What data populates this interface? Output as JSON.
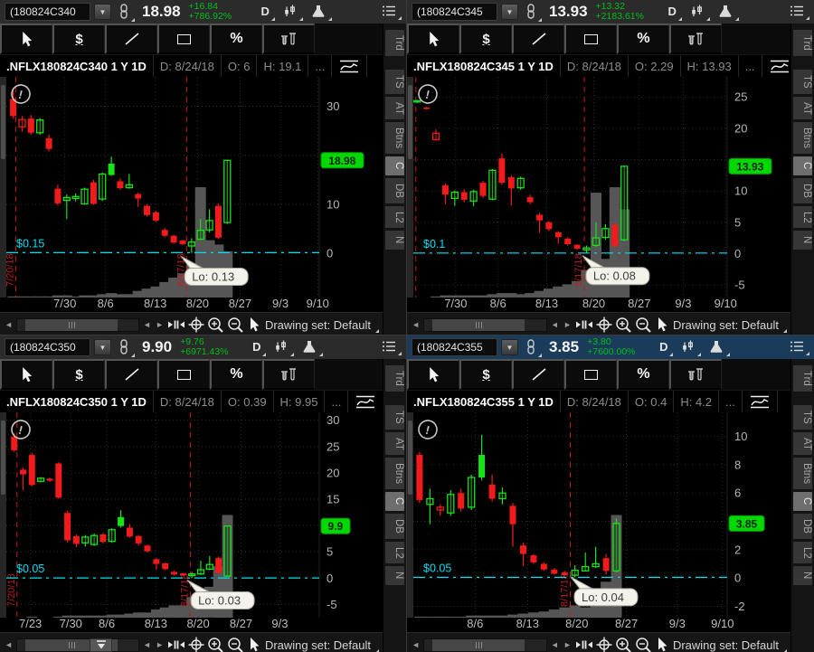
{
  "colors": {
    "candle_up": "#17e317",
    "candle_down": "#f21b1b",
    "alert_line": "#00dff2",
    "badge_bg": "#00d800",
    "date_line_red": "#c51a1a",
    "active_header_bg": "#1a3c5a",
    "change_green": "#00be18"
  },
  "sidebar_tabs": [
    "Trd",
    "TS",
    "AT",
    "Btns",
    "C",
    "DB",
    "L2",
    "N"
  ],
  "toolbar": {
    "drawing_set": "Drawing set: Default",
    "dollar": "$",
    "percent": "%"
  },
  "panels": [
    {
      "active": false,
      "show_snap": false,
      "header": {
        "symbol": "(180824C340",
        "price": "18.98",
        "change": "+16.84",
        "change_pct": "+786.92%",
        "timeframe": "D"
      },
      "title": {
        "name": ".NFLX180824C340 1 Y 1D",
        "date": "D: 8/24/18",
        "open": "O: 6",
        "high": "H: 19.1",
        "more": "..."
      },
      "chart": {
        "ylim": [
          -9,
          36
        ],
        "grid_step": 10,
        "x0": 0.022,
        "dx": 0.0285,
        "yticks": [
          [
            30,
            "30"
          ],
          [
            10,
            "10"
          ],
          [
            0,
            "0"
          ]
        ],
        "xticks": [
          [
            0.187,
            "7/30"
          ],
          [
            0.317,
            "8/6"
          ],
          [
            0.476,
            "8/13"
          ],
          [
            0.611,
            "8/20"
          ],
          [
            0.747,
            "8/27"
          ],
          [
            0.876,
            "9/3"
          ],
          [
            0.995,
            "9/10"
          ]
        ],
        "vlines": [
          {
            "frac": 0.03,
            "label": "7/20/18"
          },
          {
            "frac": 0.576,
            "label": "8/17/18"
          }
        ],
        "hline": {
          "price": 0.15,
          "label": "$0.15"
        },
        "badge": {
          "value": "18.98",
          "price": 18.98
        },
        "tooltip": {
          "text": "Lo: 0.13",
          "frac": 0.57,
          "price": -3
        },
        "candles": [
          [
            31.5,
            33.5,
            27.5,
            28,
            "r",
            0.01
          ],
          [
            25.8,
            28,
            24.8,
            27.3,
            "rh",
            0.01
          ],
          [
            27.5,
            28.2,
            24.2,
            24.6,
            "r",
            0.01
          ],
          [
            24.6,
            27.6,
            24.2,
            27.2,
            "gh",
            0.01
          ],
          [
            23.5,
            24.2,
            20.8,
            21.3,
            "r",
            0.01
          ],
          [
            13.2,
            14,
            9.8,
            10.2,
            "r",
            0.02
          ],
          [
            10.8,
            12,
            7,
            11.4,
            "gh",
            0.02
          ],
          [
            11.2,
            12.2,
            10.6,
            11.6,
            "gh",
            0.01
          ],
          [
            10.1,
            13.4,
            9.9,
            13.1,
            "gh",
            0.02
          ],
          [
            14.5,
            15,
            9.9,
            10.1,
            "r",
            0.02
          ],
          [
            11.1,
            16.5,
            10.7,
            16.2,
            "gh",
            0.03
          ],
          [
            16,
            19.7,
            15.8,
            18.3,
            "g",
            0.04
          ],
          [
            14.7,
            15.3,
            13,
            13.3,
            "r",
            0.03
          ],
          [
            13.4,
            16.2,
            13.2,
            14,
            "gh",
            0.03
          ],
          [
            12.1,
            12.4,
            9.5,
            11.2,
            "r",
            0.06
          ],
          [
            9.7,
            10,
            7.5,
            7.8,
            "r",
            0.08
          ],
          [
            8.4,
            8.6,
            6.4,
            6.7,
            "r",
            0.1
          ],
          [
            4.8,
            5.2,
            3.3,
            3.6,
            "r",
            0.14
          ],
          [
            3.6,
            3.8,
            2,
            2.2,
            "r",
            0.18
          ],
          [
            2.6,
            2.8,
            1.7,
            1.9,
            "r",
            0.22
          ],
          [
            1.5,
            3.1,
            0.13,
            2.3,
            "gh",
            0.3
          ],
          [
            2.9,
            7,
            2.7,
            4.7,
            "gh",
            1.0
          ],
          [
            4.8,
            9,
            4.3,
            6.7,
            "gh",
            0.52
          ],
          [
            9.7,
            10.2,
            2.9,
            3.2,
            "r",
            0.48
          ],
          [
            6.3,
            19.1,
            6,
            18.98,
            "gh",
            0.42
          ]
        ]
      }
    },
    {
      "active": false,
      "show_snap": false,
      "header": {
        "symbol": "(180824C345",
        "price": "13.93",
        "change": "+13.32",
        "change_pct": "+2183.61%",
        "timeframe": "D"
      },
      "title": {
        "name": ".NFLX180824C345 1 Y 1D",
        "date": "D: 8/24/18",
        "open": "O: 2.29",
        "high": "H: 13.93",
        "more": "..."
      },
      "chart": {
        "ylim": [
          -7,
          28.2
        ],
        "grid_step": 5,
        "x0": 0.012,
        "dx": 0.03,
        "yticks": [
          [
            25,
            "25"
          ],
          [
            20,
            "20"
          ],
          [
            10,
            "10"
          ],
          [
            5,
            "5"
          ],
          [
            0,
            "0"
          ],
          [
            -5,
            "-5"
          ]
        ],
        "xticks": [
          [
            0.135,
            "7/30"
          ],
          [
            0.27,
            "8/6"
          ],
          [
            0.425,
            "8/13"
          ],
          [
            0.575,
            "8/20"
          ],
          [
            0.72,
            "8/27"
          ],
          [
            0.86,
            "9/3"
          ],
          [
            0.995,
            "9/10"
          ]
        ],
        "vlines": [
          {
            "frac": 0.008,
            "label": ""
          },
          {
            "frac": 0.545,
            "label": "8/17/18"
          }
        ],
        "hline": {
          "price": 0.1,
          "label": "$0.1"
        },
        "badge": {
          "value": "13.93",
          "price": 13.93
        },
        "tooltip": {
          "text": "Lo: 0.08",
          "frac": 0.55,
          "price": -2.2
        },
        "candles": [
          [
            24.2,
            24.5,
            24,
            24.4,
            "gh",
            0
          ],
          [
            23.1,
            23.4,
            23,
            23.3,
            "r",
            0
          ],
          [
            18.2,
            19.8,
            18,
            19.2,
            "rh",
            0.01
          ],
          [
            10.9,
            11.2,
            7.9,
            9.4,
            "r",
            0.02
          ],
          [
            8.8,
            10.1,
            7.6,
            9.8,
            "gh",
            0.02
          ],
          [
            9.8,
            10.3,
            8.2,
            8.6,
            "r",
            0.02
          ],
          [
            8.4,
            10.2,
            7.6,
            9.9,
            "gh",
            0.02
          ],
          [
            11.3,
            11.6,
            8.9,
            9.2,
            "r",
            0.02
          ],
          [
            8.7,
            13.5,
            8.5,
            13.3,
            "gh",
            0.03
          ],
          [
            15.2,
            16,
            11,
            11.3,
            "r",
            0.04
          ],
          [
            12.2,
            12.5,
            7.7,
            10.4,
            "r",
            0.04
          ],
          [
            10.5,
            12.3,
            10.2,
            12,
            "gh",
            0.03
          ],
          [
            9,
            9.4,
            7.9,
            8.2,
            "r",
            0.04
          ],
          [
            6.2,
            6.5,
            3.3,
            5.3,
            "r",
            0.06
          ],
          [
            5,
            5.2,
            3.6,
            3.9,
            "r",
            0.08
          ],
          [
            3.4,
            3.6,
            1.6,
            2.6,
            "r",
            0.1
          ],
          [
            2.4,
            2.6,
            1.3,
            1.5,
            "r",
            0.12
          ],
          [
            1.4,
            1.5,
            0.6,
            0.8,
            "r",
            0.15
          ],
          [
            0.6,
            1.3,
            0.08,
            0.9,
            "gh",
            0.25
          ],
          [
            1.3,
            5,
            1,
            2.5,
            "gh",
            0.95
          ],
          [
            2.6,
            4.7,
            2.2,
            4,
            "gh",
            0.35
          ],
          [
            4.6,
            5,
            0.9,
            1.2,
            "r",
            1.0
          ],
          [
            2.2,
            14,
            2,
            13.93,
            "gh",
            0.8
          ]
        ]
      }
    },
    {
      "active": false,
      "show_snap": true,
      "header": {
        "symbol": "(180824C350",
        "price": "9.90",
        "change": "+9.76",
        "change_pct": "+6971.43%",
        "timeframe": "D"
      },
      "title": {
        "name": ".NFLX180824C350 1 Y 1D",
        "date": "D: 8/24/18",
        "open": "O: 0.39",
        "high": "H: 9.95",
        "more": "..."
      },
      "chart": {
        "ylim": [
          -7.5,
          31.5
        ],
        "grid_step": 5,
        "x0": 0.025,
        "dx": 0.0284,
        "yticks": [
          [
            30,
            "30"
          ],
          [
            25,
            "25"
          ],
          [
            20,
            "20"
          ],
          [
            15,
            "15"
          ],
          [
            5,
            "5"
          ],
          [
            0,
            "0"
          ],
          [
            -5,
            "-5"
          ]
        ],
        "xticks": [
          [
            0.077,
            "7/23"
          ],
          [
            0.206,
            "7/30"
          ],
          [
            0.321,
            "8/6"
          ],
          [
            0.478,
            "8/13"
          ],
          [
            0.613,
            "8/20"
          ],
          [
            0.75,
            "8/27"
          ],
          [
            0.874,
            "9/3"
          ]
        ],
        "vlines": [
          {
            "frac": 0.034,
            "label": "7/20/18"
          },
          {
            "frac": 0.588,
            "label": "8/17/18"
          }
        ],
        "hline": {
          "price": 0.05,
          "label": "$0.05"
        },
        "badge": {
          "value": "9.9",
          "price": 9.9
        },
        "tooltip": {
          "text": "Lo: 0.03",
          "frac": 0.59,
          "price": -2.6
        },
        "candles": [
          [
            26.9,
            27.5,
            24,
            24.3,
            "r",
            0
          ],
          [
            20.6,
            21,
            16.7,
            19.7,
            "r",
            0
          ],
          [
            23.4,
            23.8,
            17.5,
            17.7,
            "r",
            0.01
          ],
          [
            18.4,
            19.2,
            18.2,
            19,
            "gh",
            0
          ],
          [
            18.9,
            19.1,
            18.3,
            18.5,
            "r",
            0
          ],
          [
            21.8,
            22,
            15.1,
            15.3,
            "r",
            0.01
          ],
          [
            12.4,
            12.8,
            6.8,
            7.2,
            "r",
            0.02
          ],
          [
            8,
            8.3,
            5.9,
            6.5,
            "r",
            0.02
          ],
          [
            6.7,
            8.2,
            6,
            7.8,
            "gh",
            0.02
          ],
          [
            6.4,
            8.5,
            6.1,
            8.1,
            "gh",
            0.02
          ],
          [
            8.3,
            8.6,
            6.6,
            6.9,
            "r",
            0.02
          ],
          [
            7,
            9.5,
            6.7,
            9.2,
            "gh",
            0.03
          ],
          [
            9.9,
            12.9,
            9.6,
            11.6,
            "g",
            0.03
          ],
          [
            9.6,
            10.3,
            7.7,
            7.9,
            "r",
            0.04
          ],
          [
            8,
            8.2,
            6.2,
            6.6,
            "r",
            0.05
          ],
          [
            6.2,
            6.4,
            4.9,
            5.1,
            "r",
            0.05
          ],
          [
            3.6,
            3.8,
            1.6,
            2.7,
            "r",
            0.08
          ],
          [
            2.8,
            3,
            1.5,
            1.7,
            "r",
            0.1
          ],
          [
            1.2,
            1.4,
            0.5,
            0.7,
            "r",
            0.12
          ],
          [
            0.9,
            1,
            0.4,
            0.5,
            "r",
            0.12
          ],
          [
            0.5,
            1.2,
            0.03,
            0.8,
            "gh",
            0.2
          ],
          [
            0.8,
            3.3,
            0.6,
            1.6,
            "gh",
            0.25
          ],
          [
            1.7,
            4.2,
            1.5,
            2.6,
            "gh",
            0.3
          ],
          [
            3.8,
            4.1,
            0.8,
            1,
            "r",
            0.5
          ],
          [
            0.4,
            9.95,
            0.3,
            9.9,
            "gh",
            1.0
          ]
        ]
      }
    },
    {
      "active": true,
      "show_snap": false,
      "header": {
        "symbol": "(180824C355",
        "price": "3.85",
        "change": "+3.80",
        "change_pct": "+7600.00%",
        "timeframe": "D"
      },
      "title": {
        "name": ".NFLX180824C355 1 Y 1D",
        "date": "D: 8/24/18",
        "open": "O: 0.4",
        "high": "H: 4.2",
        "more": "..."
      },
      "chart": {
        "ylim": [
          -2.8,
          11.7
        ],
        "grid_step": 2,
        "x0": 0.02,
        "dx": 0.033,
        "yticks": [
          [
            10,
            "10"
          ],
          [
            8,
            "8"
          ],
          [
            6,
            "6"
          ],
          [
            2,
            "2"
          ],
          [
            0,
            "0"
          ],
          [
            -2,
            "-2"
          ]
        ],
        "xticks": [
          [
            0.197,
            "8/6"
          ],
          [
            0.364,
            "8/13"
          ],
          [
            0.521,
            "8/20"
          ],
          [
            0.679,
            "8/27"
          ],
          [
            0.841,
            "9/3"
          ],
          [
            0.985,
            "9/10"
          ]
        ],
        "vlines": [
          {
            "frac": 0.5,
            "label": "8/17/18"
          }
        ],
        "hline": {
          "price": 0.05,
          "label": "$0.05"
        },
        "badge": {
          "value": "3.85",
          "price": 3.85
        },
        "tooltip": {
          "text": "Lo: 0.04",
          "frac": 0.513,
          "price": -0.75
        },
        "candles": [
          [
            8.7,
            8.9,
            5.3,
            5.5,
            "r",
            0.01
          ],
          [
            5.2,
            6.3,
            3.8,
            5.6,
            "gh",
            0.01
          ],
          [
            5,
            5.2,
            4.4,
            4.8,
            "rh",
            0.01
          ],
          [
            4.6,
            6.2,
            4.4,
            5.9,
            "gh",
            0.01
          ],
          [
            6,
            6.3,
            4.7,
            4.9,
            "r",
            0.01
          ],
          [
            5,
            7.3,
            4.8,
            7.1,
            "gh",
            0.02
          ],
          [
            7.1,
            10.1,
            6.9,
            8.7,
            "g",
            0.02
          ],
          [
            6.6,
            7.3,
            5.4,
            5.6,
            "r",
            0.02
          ],
          [
            5.6,
            6.4,
            5.2,
            6,
            "gh",
            0.02
          ],
          [
            5.1,
            5.3,
            2.2,
            3.8,
            "r",
            0.03
          ],
          [
            2.3,
            2.5,
            0.85,
            1.7,
            "r",
            0.04
          ],
          [
            1.6,
            1.7,
            1,
            1.1,
            "r",
            0.05
          ],
          [
            1,
            1.1,
            0.5,
            0.6,
            "r",
            0.06
          ],
          [
            0.6,
            0.7,
            0.25,
            0.3,
            "r",
            0.08
          ],
          [
            0.4,
            0.5,
            0.15,
            0.2,
            "r",
            0.1
          ],
          [
            0.2,
            0.9,
            0.04,
            0.55,
            "gh",
            0.12
          ],
          [
            0.5,
            1.8,
            0.45,
            0.8,
            "gh",
            0.1
          ],
          [
            0.8,
            2.2,
            0.7,
            1,
            "gh",
            0.12
          ],
          [
            1.4,
            1.7,
            0.24,
            0.5,
            "r",
            0.35
          ],
          [
            0.5,
            4.2,
            0.4,
            3.85,
            "gh",
            1.0
          ]
        ]
      }
    }
  ]
}
